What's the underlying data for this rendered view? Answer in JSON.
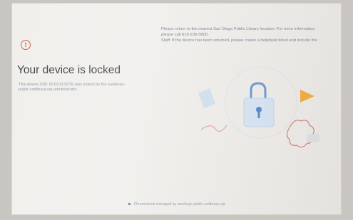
{
  "header": {
    "warning_icon": "alert-circle-icon",
    "title": "Your device is locked",
    "description": "This device (SN: 5CD2313279) was locked by the sandiego-public.cwlibrary.org administrator."
  },
  "notice": {
    "line1": "Please return to the nearest San Diego Public Library location.  For more information",
    "line2": "please call 619-236-5800.",
    "line3": "Staff: If the device has been returned, please create a helpdesk ticket and include the"
  },
  "footer": {
    "text": "Chromebook managed by sandiego-public.cwlibrary.org"
  },
  "colors": {
    "accent_red": "#d9584f",
    "lock_blue": "#5b8fd6",
    "triangle_orange": "#f5a623",
    "background": "#f1efec"
  }
}
